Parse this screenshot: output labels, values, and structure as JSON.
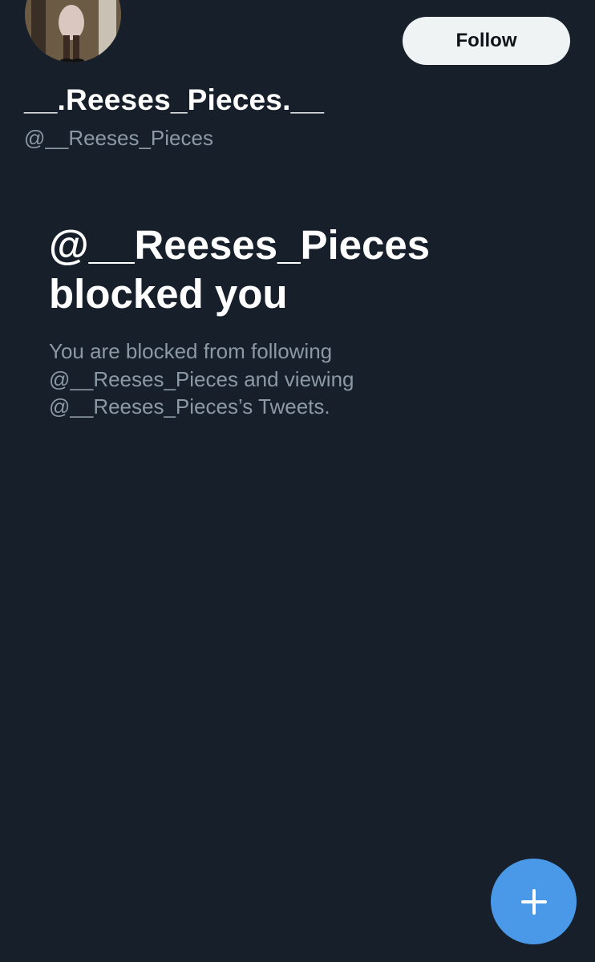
{
  "profile": {
    "display_name": "__.Reeses_Pieces.__",
    "handle": "@__Reeses_Pieces",
    "follow_label": "Follow"
  },
  "blocked": {
    "title_line1": "@__Reeses_Pieces",
    "title_line2": "blocked you",
    "desc_line1": "You are blocked from following",
    "desc_line2": "@__Reeses_Pieces and viewing",
    "desc_line3": "@__Reeses_Pieces’s Tweets."
  },
  "compose": {
    "icon": "plus-icon"
  },
  "colors": {
    "background": "#17202a",
    "primary_text": "#ffffff",
    "secondary_text": "#8b98a5",
    "follow_button_bg": "#eff3f4",
    "compose_button_bg": "#4a99e9"
  }
}
